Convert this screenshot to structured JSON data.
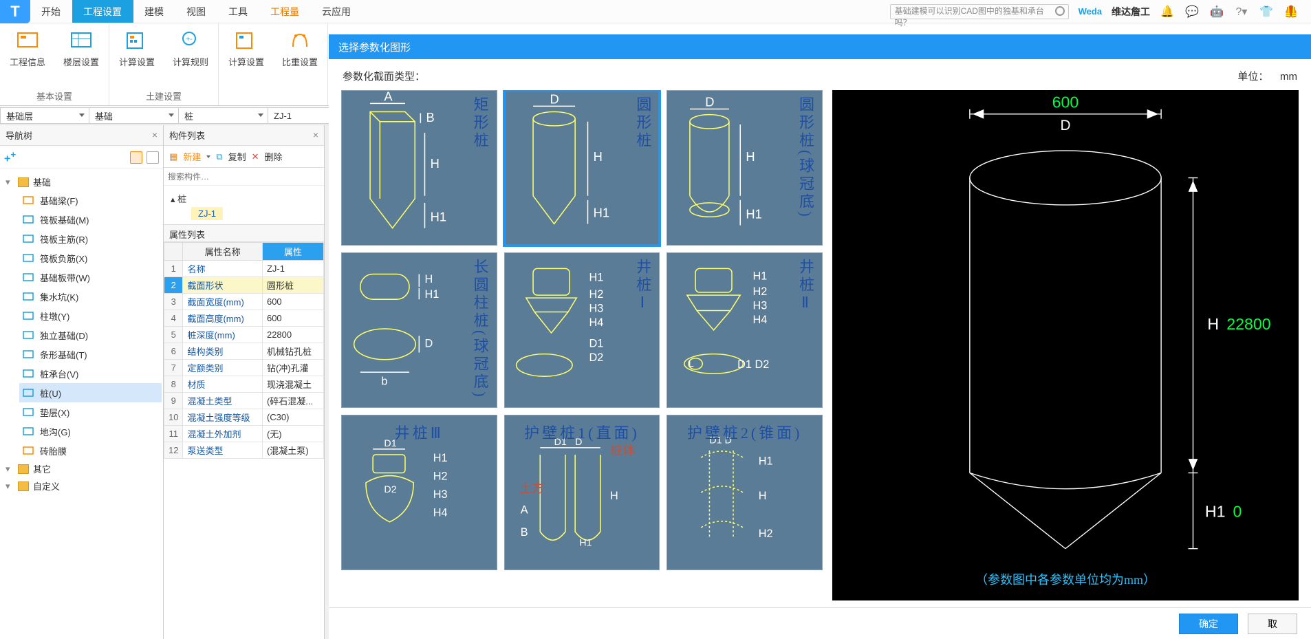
{
  "topbar": {
    "logo": "T",
    "tabs": [
      "开始",
      "工程设置",
      "建模",
      "视图",
      "工具",
      "工程量",
      "云应用"
    ],
    "active_index": 1,
    "orange_index": 5,
    "search_placeholder": "基础建模可以识别CAD图中的独基和承台吗？",
    "brand_logo": "Weda",
    "brand_text": "维达詹工",
    "icons": [
      "bell-icon",
      "chat-icon",
      "robot-icon",
      "help-icon",
      "tshirt-icon",
      "vest-icon"
    ]
  },
  "ribbon": {
    "groups": [
      {
        "title": "基本设置",
        "items": [
          "工程信息",
          "楼层设置"
        ]
      },
      {
        "title": "土建设置",
        "items": [
          "计算设置",
          "计算规则"
        ]
      },
      {
        "title": "",
        "items": [
          "计算设置",
          "比重设置"
        ]
      }
    ]
  },
  "filters": [
    "基础层",
    "基础",
    "桩",
    "ZJ-1"
  ],
  "nav": {
    "title": "导航树",
    "groups": [
      {
        "name": "基础",
        "items": [
          {
            "label": "基础梁(F)",
            "key": "F"
          },
          {
            "label": "筏板基础(M)",
            "key": "M"
          },
          {
            "label": "筏板主筋(R)",
            "key": "R"
          },
          {
            "label": "筏板负筋(X)",
            "key": "X"
          },
          {
            "label": "基础板带(W)",
            "key": "W"
          },
          {
            "label": "集水坑(K)",
            "key": "K"
          },
          {
            "label": "柱墩(Y)",
            "key": "Y"
          },
          {
            "label": "独立基础(D)",
            "key": "D"
          },
          {
            "label": "条形基础(T)",
            "key": "T"
          },
          {
            "label": "桩承台(V)",
            "key": "V"
          },
          {
            "label": "桩(U)",
            "key": "U",
            "selected": true
          },
          {
            "label": "垫层(X)",
            "key": "X2"
          },
          {
            "label": "地沟(G)",
            "key": "G"
          },
          {
            "label": "砖胎膜",
            "key": "Z"
          }
        ]
      },
      {
        "name": "其它",
        "items": []
      },
      {
        "name": "自定义",
        "items": []
      }
    ]
  },
  "componentList": {
    "title": "构件列表",
    "btn_new": "新建",
    "btn_copy": "复制",
    "btn_del": "删除",
    "search_placeholder": "搜索构件…",
    "root": "桩",
    "leaf": "ZJ-1"
  },
  "props": {
    "title": "属性列表",
    "headers": [
      "",
      "属性名称",
      "属性"
    ],
    "rows": [
      {
        "i": 1,
        "name": "名称",
        "val": "ZJ-1"
      },
      {
        "i": 2,
        "name": "截面形状",
        "val": "圆形桩",
        "hl": true
      },
      {
        "i": 3,
        "name": "截面宽度(mm)",
        "val": "600"
      },
      {
        "i": 4,
        "name": "截面高度(mm)",
        "val": "600"
      },
      {
        "i": 5,
        "name": "桩深度(mm)",
        "val": "22800"
      },
      {
        "i": 6,
        "name": "结构类别",
        "val": "机械钻孔桩"
      },
      {
        "i": 7,
        "name": "定额类别",
        "val": "钻(冲)孔灌"
      },
      {
        "i": 8,
        "name": "材质",
        "val": "现浇混凝土"
      },
      {
        "i": 9,
        "name": "混凝土类型",
        "val": "(碎石混凝..."
      },
      {
        "i": 10,
        "name": "混凝土强度等级",
        "val": "(C30)"
      },
      {
        "i": 11,
        "name": "混凝土外加剂",
        "val": "(无)"
      },
      {
        "i": 12,
        "name": "泵送类型",
        "val": "(混凝土泵)"
      }
    ]
  },
  "dialog": {
    "title": "选择参数化图形",
    "left_label": "参数化截面类型：",
    "unit_label": "单位：",
    "unit_value": "mm",
    "shapes": [
      {
        "name": "矩形桩"
      },
      {
        "name": "圆形桩",
        "selected": true
      },
      {
        "name": "圆形桩(球冠底)"
      },
      {
        "name": "长圆柱桩(球冠底)"
      },
      {
        "name": "井桩Ⅰ"
      },
      {
        "name": "井桩Ⅱ"
      },
      {
        "name": "井桩Ⅲ",
        "horiz": true
      },
      {
        "name": "护壁桩1(直面)",
        "horiz": true
      },
      {
        "name": "护壁桩2(锥面)",
        "horiz": true
      }
    ],
    "preview": {
      "D": "600",
      "D_label": "D",
      "H": "22800",
      "H_label": "H",
      "H1": "0",
      "H1_label": "H1",
      "note": "（参数图中各参数单位均为mm）"
    },
    "ok": "确定",
    "cancel": "取"
  }
}
